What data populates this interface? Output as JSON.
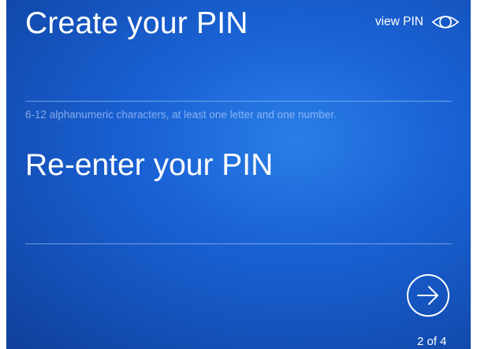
{
  "create": {
    "title": "Create your PIN",
    "hint": "6-12 alphanumeric characters, at least one letter and one number."
  },
  "view_pin": {
    "label": "view PIN",
    "icon": "eye-icon"
  },
  "reenter": {
    "title": "Re-enter your PIN"
  },
  "next": {
    "icon": "arrow-right-icon"
  },
  "progress": {
    "label": "2 of 4",
    "current_step": 2,
    "total_steps": 4
  },
  "colors": {
    "background": "#1a63d6",
    "text": "#ffffff",
    "hint": "#c8dcff"
  }
}
